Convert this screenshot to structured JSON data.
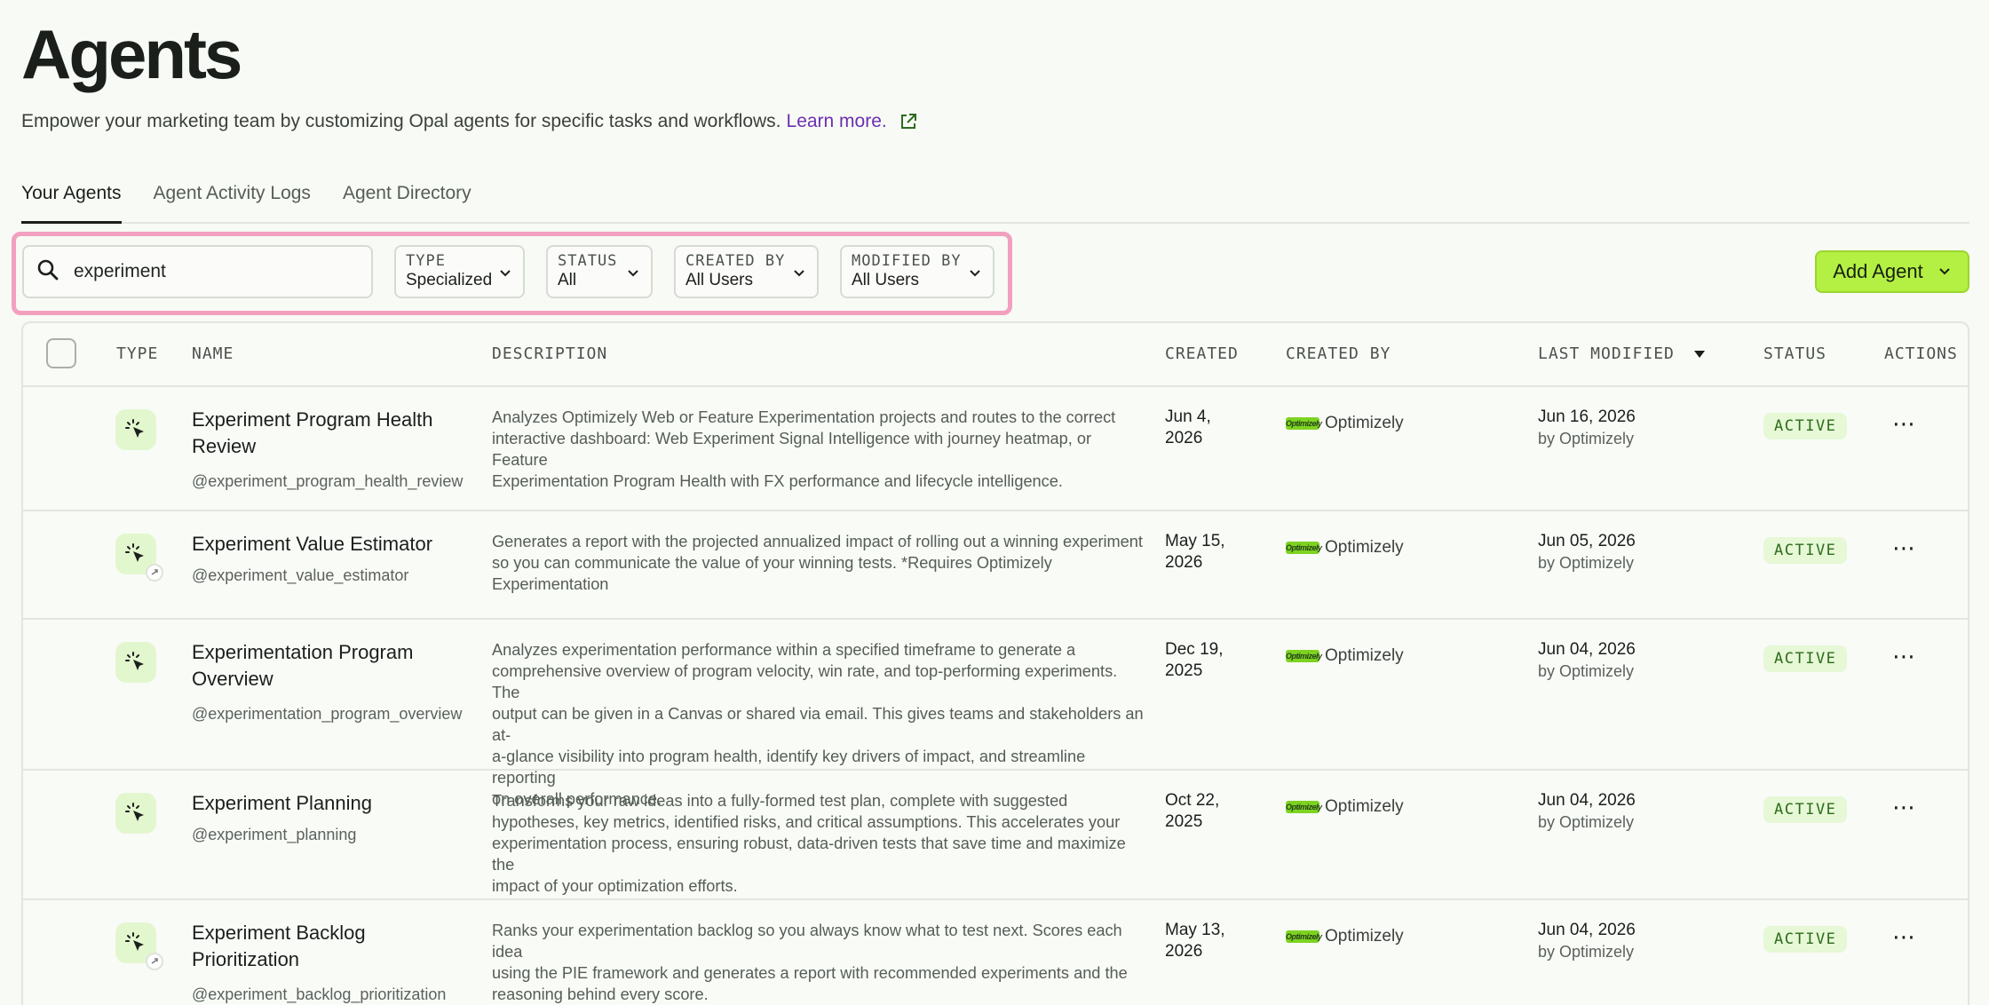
{
  "header": {
    "title": "Agents",
    "subtitle": "Empower your marketing team by customizing Opal agents for specific tasks and workflows.",
    "learn_more": "Learn more."
  },
  "tabs": [
    {
      "label": "Your Agents",
      "active": true
    },
    {
      "label": "Agent Activity Logs",
      "active": false
    },
    {
      "label": "Agent Directory",
      "active": false
    }
  ],
  "search": {
    "value": "experiment"
  },
  "filters": {
    "type": {
      "label": "TYPE",
      "value": "Specialized"
    },
    "status": {
      "label": "STATUS",
      "value": "All"
    },
    "created_by": {
      "label": "CREATED BY",
      "value": "All Users"
    },
    "modified_by": {
      "label": "MODIFIED BY",
      "value": "All Users"
    }
  },
  "add_button": {
    "label": "Add Agent"
  },
  "columns": {
    "type": "TYPE",
    "name": "NAME",
    "description": "DESCRIPTION",
    "created": "CREATED",
    "created_by": "CREATED BY",
    "last_modified": "LAST MODIFIED",
    "status": "STATUS",
    "actions": "ACTIONS"
  },
  "logo_text": "Optimizely",
  "rows": [
    {
      "name_1": "Experiment Program Health",
      "name_2": "Review",
      "handle": "@experiment_program_health_review",
      "desc_lines": [
        "Analyzes Optimizely Web or Feature Experimentation projects and routes to the correct",
        "interactive dashboard: Web Experiment Signal Intelligence with journey heatmap, or Feature",
        "Experimentation Program Health with FX performance and lifecycle intelligence."
      ],
      "created_1": "Jun 4,",
      "created_2": "2026",
      "created_by": "Optimizely",
      "modified": "Jun 16, 2026",
      "modified_by": "by Optimizely",
      "status": "ACTIVE"
    },
    {
      "name_1": "Experiment Value Estimator",
      "name_2": "",
      "handle": "@experiment_value_estimator",
      "desc_lines": [
        "Generates a report with the projected annualized impact of rolling out a winning experiment",
        "so you can communicate the value of your winning tests. *Requires Optimizely",
        "Experimentation"
      ],
      "created_1": "May 15,",
      "created_2": "2026",
      "created_by": "Optimizely",
      "modified": "Jun 05, 2026",
      "modified_by": "by Optimizely",
      "status": "ACTIVE"
    },
    {
      "name_1": "Experimentation Program",
      "name_2": "Overview",
      "handle": "@experimentation_program_overview",
      "desc_lines": [
        "Analyzes experimentation performance within a specified timeframe to generate a",
        "comprehensive overview of program velocity, win rate, and top-performing experiments. The",
        "output can be given in a Canvas or shared via email. This gives teams and stakeholders an at-",
        "a-glance visibility into program health, identify key drivers of impact, and streamline reporting",
        "on overall performance."
      ],
      "created_1": "Dec 19,",
      "created_2": "2025",
      "created_by": "Optimizely",
      "modified": "Jun 04, 2026",
      "modified_by": "by Optimizely",
      "status": "ACTIVE"
    },
    {
      "name_1": "Experiment Planning",
      "name_2": "",
      "handle": "@experiment_planning",
      "desc_lines": [
        "Transforms your raw ideas into a fully-formed test plan, complete with suggested",
        "hypotheses, key metrics, identified risks, and critical assumptions. This accelerates your",
        "experimentation process, ensuring robust, data-driven tests that save time and maximize the",
        "impact of your optimization efforts."
      ],
      "created_1": "Oct 22,",
      "created_2": "2025",
      "created_by": "Optimizely",
      "modified": "Jun 04, 2026",
      "modified_by": "by Optimizely",
      "status": "ACTIVE"
    },
    {
      "name_1": "Experiment Backlog",
      "name_2": "Prioritization",
      "handle": "@experiment_backlog_prioritization",
      "desc_lines": [
        "Ranks your experimentation backlog so you always know what to test next. Scores each idea",
        "using the PIE framework and generates a report with recommended experiments and the",
        "reasoning behind every score."
      ],
      "created_1": "May 13,",
      "created_2": "2026",
      "created_by": "Optimizely",
      "modified": "Jun 04, 2026",
      "modified_by": "by Optimizely",
      "status": "ACTIVE"
    }
  ]
}
